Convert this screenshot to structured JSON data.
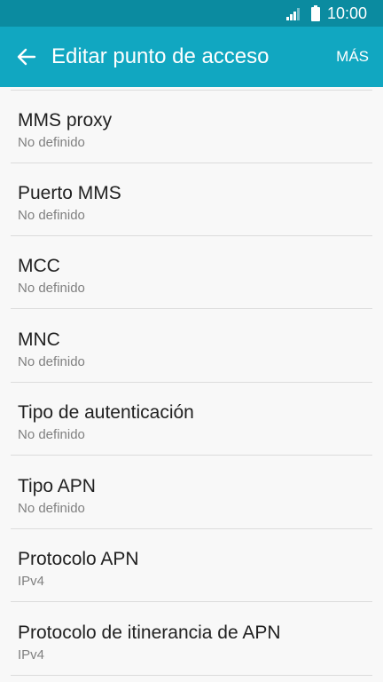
{
  "status_bar": {
    "time": "10:00",
    "signal_icon": "signal-icon",
    "battery_icon": "battery-icon"
  },
  "app_bar": {
    "back_icon": "arrow-left-icon",
    "title": "Editar punto de acceso",
    "more_label": "MÁS"
  },
  "colors": {
    "status_bar": "#0b8ba0",
    "app_bar": "#11a7c1",
    "background": "#f8f8f8"
  },
  "items": [
    {
      "title": "MMS proxy",
      "value": "No definido"
    },
    {
      "title": "Puerto MMS",
      "value": "No definido"
    },
    {
      "title": "MCC",
      "value": "No definido"
    },
    {
      "title": "MNC",
      "value": "No definido"
    },
    {
      "title": "Tipo de autenticación",
      "value": "No definido"
    },
    {
      "title": "Tipo APN",
      "value": "No definido"
    },
    {
      "title": "Protocolo APN",
      "value": "IPv4"
    },
    {
      "title": "Protocolo de itinerancia de APN",
      "value": "IPv4"
    }
  ]
}
